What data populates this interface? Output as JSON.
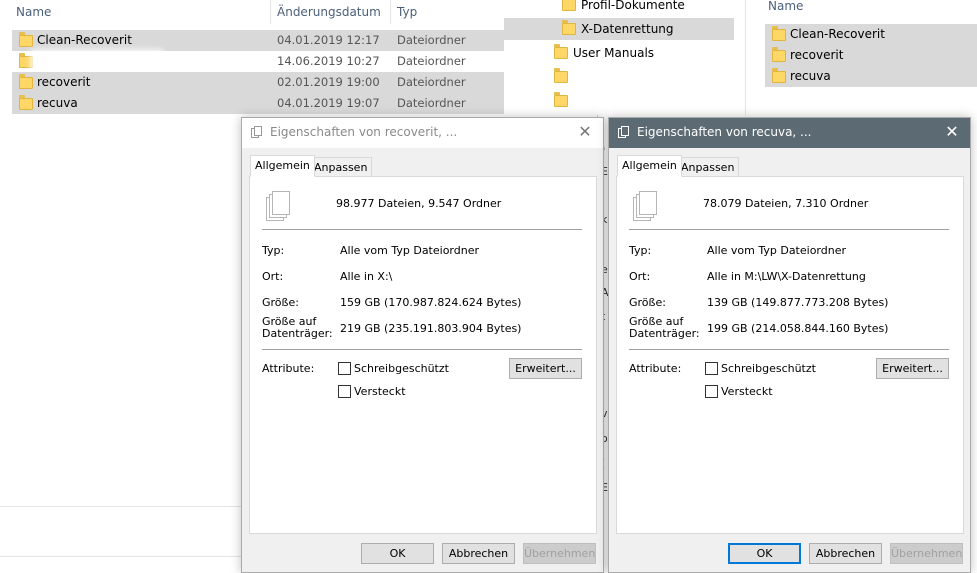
{
  "explorer_left": {
    "columns": {
      "name": "Name",
      "date": "Änderungsdatum",
      "type": "Typ"
    },
    "rows": [
      {
        "name": "Clean-Recoverit",
        "date": "04.01.2019 12:17",
        "type": "Dateiordner",
        "selected": true
      },
      {
        "name": "",
        "date": "14.06.2019 10:27",
        "type": "Dateiordner",
        "selected": false
      },
      {
        "name": "recoverit",
        "date": "02.01.2019 19:00",
        "type": "Dateiordner",
        "selected": true
      },
      {
        "name": "recuva",
        "date": "04.01.2019 19:07",
        "type": "Dateiordner",
        "selected": true
      }
    ]
  },
  "tree": {
    "items": [
      {
        "label": "Profil-Dokumente"
      },
      {
        "label": "X-Datenrettung"
      },
      {
        "label": "User Manuals"
      },
      {
        "label": ""
      },
      {
        "label": ""
      }
    ]
  },
  "explorer_right": {
    "column_name": "Name",
    "items": [
      "Clean-Recoverit",
      "recoverit",
      "recuva"
    ]
  },
  "dialog_left": {
    "title": "Eigenschaften von recoverit, ...",
    "tabs": [
      "Allgemein",
      "Anpassen"
    ],
    "summary": "98.977 Dateien, 9.547 Ordner",
    "type_label": "Typ:",
    "type_value": "Alle vom Typ Dateiordner",
    "location_label": "Ort:",
    "location_value": "Alle in X:\\",
    "size_label": "Größe:",
    "size_value": "159 GB (170.987.824.624 Bytes)",
    "disk_label_1": "Größe auf",
    "disk_label_2": "Datenträger:",
    "disk_value": "219 GB (235.191.803.904 Bytes)",
    "attributes_label": "Attribute:",
    "readonly_label": "Schreibgeschützt",
    "hidden_label": "Versteckt",
    "advanced_button": "Erweitert...",
    "ok": "OK",
    "cancel": "Abbrechen",
    "apply": "Übernehmen"
  },
  "dialog_right": {
    "title": "Eigenschaften von recuva, ...",
    "tabs": [
      "Allgemein",
      "Anpassen"
    ],
    "summary": "78.079 Dateien, 7.310 Ordner",
    "type_label": "Typ:",
    "type_value": "Alle vom Typ Dateiordner",
    "location_label": "Ort:",
    "location_value": "Alle in M:\\LW\\X-Datenrettung",
    "size_label": "Größe:",
    "size_value": "139 GB (149.877.773.208 Bytes)",
    "disk_label_1": "Größe auf",
    "disk_label_2": "Datenträger:",
    "disk_value": "199 GB (214.058.844.160 Bytes)",
    "attributes_label": "Attribute:",
    "readonly_label": "Schreibgeschützt",
    "hidden_label": "Versteckt",
    "advanced_button": "Erweitert...",
    "ok": "OK",
    "cancel": "Abbrechen",
    "apply": "Übernehmen"
  },
  "icons": {
    "folder": "folder-icon",
    "close": "close-icon",
    "properties": "folder-stack-icon"
  },
  "colors": {
    "selection": "#d9d9d9",
    "active_titlebar": "#5c6b73",
    "folder": "#ffd766",
    "default_button_border": "#0078d7"
  }
}
